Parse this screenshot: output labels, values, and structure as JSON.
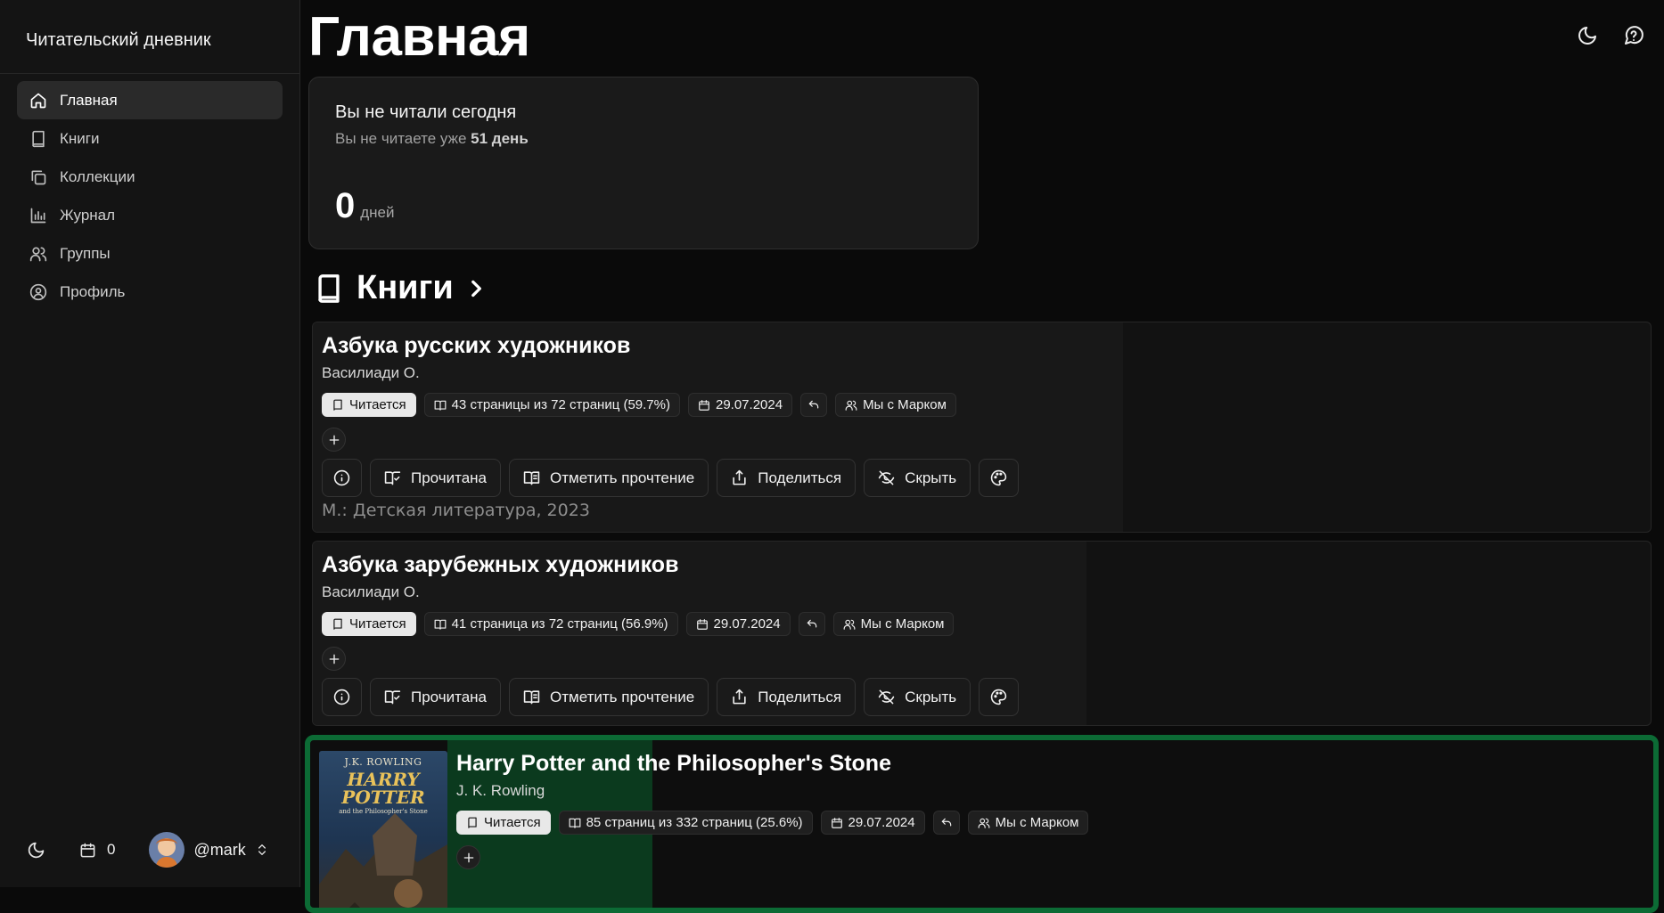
{
  "app": {
    "title": "Читательский дневник"
  },
  "sidebar": {
    "items": [
      {
        "label": "Главная",
        "icon": "home-icon",
        "active": true
      },
      {
        "label": "Книги",
        "icon": "book-icon"
      },
      {
        "label": "Коллекции",
        "icon": "copy-icon"
      },
      {
        "label": "Журнал",
        "icon": "chart-icon"
      },
      {
        "label": "Группы",
        "icon": "users-icon"
      },
      {
        "label": "Профиль",
        "icon": "user-circle-icon"
      }
    ],
    "footer": {
      "streak": "0",
      "username": "@mark"
    }
  },
  "page": {
    "title": "Главная"
  },
  "today": {
    "title": "Вы не читали сегодня",
    "sub_prefix": "Вы не читаете уже",
    "sub_bold": "51 день",
    "count": "0",
    "unit": "дней"
  },
  "books_section": {
    "title": "Книги"
  },
  "books": [
    {
      "title": "Азбука русских художников",
      "author": "Василиади О.",
      "status": "Читается",
      "progress": "43 страницы из 72 страниц (59.7%)",
      "progress_fraction": 0.597,
      "date": "29.07.2024",
      "group": "Мы с Марком",
      "publisher": "М.: Детская литература, 2023"
    },
    {
      "title": "Азбука зарубежных художников",
      "author": "Василиади О.",
      "status": "Читается",
      "progress": "41 страница из 72 страниц (56.9%)",
      "progress_fraction": 0.569,
      "date": "29.07.2024",
      "group": "Мы с Марком"
    },
    {
      "title": "Harry Potter and the Philosopher's Stone",
      "author": "J. K. Rowling",
      "status": "Читается",
      "progress": "85 страниц из 332 страниц (25.6%)",
      "progress_fraction": 0.256,
      "date": "29.07.2024",
      "group": "Мы с Марком",
      "cover": {
        "author": "J.K. ROWLING",
        "title_line1": "HARRY",
        "title_line2": "POTTER",
        "subtitle": "and the Philosopher's Stone"
      }
    }
  ],
  "actions": {
    "read": "Прочитана",
    "mark": "Отметить прочтение",
    "share": "Поделиться",
    "hide": "Скрыть"
  },
  "colors": {
    "highlight": "#0c6b35",
    "background": "#0a0a0a"
  }
}
